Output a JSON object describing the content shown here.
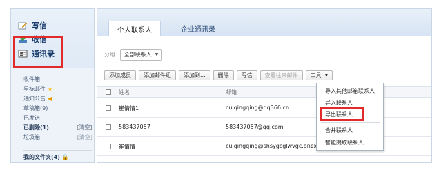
{
  "nav": {
    "compose": "写信",
    "inbox": "收信",
    "contacts": "通讯录"
  },
  "folders": [
    {
      "label": "收件箱",
      "badge": "",
      "clear": ""
    },
    {
      "label": "星标邮件",
      "badge": "star",
      "clear": ""
    },
    {
      "label": "通知公告",
      "badge": "speaker",
      "clear": ""
    },
    {
      "label": "草稿箱(9)",
      "badge": "",
      "clear": ""
    },
    {
      "label": "已发送",
      "badge": "",
      "clear": ""
    },
    {
      "label": "已删除(1)",
      "badge": "",
      "clear": "[清空]"
    },
    {
      "label": "垃圾箱",
      "badge": "",
      "clear": "[清空]"
    }
  ],
  "my_folders": "我的文件夹(4)",
  "tabs": {
    "personal": "个人联系人",
    "enterprise": "企业通讯录"
  },
  "group": {
    "label": "分组:",
    "selected": "全部联系人"
  },
  "toolbar": {
    "add_member": "添加成员",
    "add_group": "添加邮件组",
    "add_to": "添加到...",
    "delete": "删除",
    "write": "写信",
    "view_history": "查看往来邮件",
    "tools": "工具"
  },
  "table": {
    "col_name": "姓名",
    "col_email": "邮箱",
    "rows": [
      {
        "name": "崔情情1",
        "email": "cuiqingqing@qq366.cn"
      },
      {
        "name": "583437057",
        "email": "583437057@qq.com"
      },
      {
        "name": "崔情情",
        "email": "cuiqingqing@shsygcglwvgc.onexmai"
      }
    ]
  },
  "tools_menu": [
    "导入其他邮箱联系人",
    "导入联系人",
    "导出联系人",
    "合并联系人",
    "智能提取联系人"
  ],
  "colors": {
    "highlight": "#e12a2a",
    "nav_text": "#1a3d6d",
    "panel_bg": "#eef3f9"
  }
}
